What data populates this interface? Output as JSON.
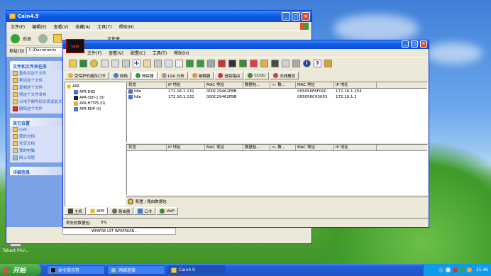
{
  "desktop": {
    "icons": [
      {
        "label": "Tekart Priv..."
      }
    ]
  },
  "explorer": {
    "title": "Cain4.9",
    "menu": [
      "文件(F)",
      "编辑(E)",
      "查看(V)",
      "收藏(A)",
      "工具(T)",
      "帮助(H)"
    ],
    "toolbar": {
      "back": "后退",
      "folders": "文件夹"
    },
    "address_label": "地址(D)",
    "address_value": "C:\\Documents",
    "tasks_panel": {
      "header": "文件和文件夹任务",
      "items": [
        "重命名这个文件",
        "移动这个文件",
        "复制这个文件",
        "将这个文件发布",
        "以电子邮件形式发送此文件",
        "删除这个文件"
      ]
    },
    "places_panel": {
      "header": "其它位置",
      "items": [
        "cain",
        "我的文档",
        "共享文档",
        "我的电脑",
        "网上邻居"
      ]
    },
    "details_panel": {
      "header": "详细信息"
    }
  },
  "cain": {
    "menu": [
      "文件(F)",
      "查看(V)",
      "配置(C)",
      "工具(T)",
      "帮助(H)"
    ],
    "tabs": [
      {
        "label": "受保护的缓存口令",
        "color": "#d8b23c"
      },
      {
        "label": "网络",
        "color": "#3c7fd8"
      },
      {
        "label": "嗅探器",
        "color": "#2d9a3a"
      },
      {
        "label": "LSA 分析",
        "color": "#9a9a9a"
      },
      {
        "label": "破解器",
        "color": "#c8a040"
      },
      {
        "label": "追踪路由",
        "color": "#cc3333"
      },
      {
        "label": "CCDU",
        "color": "#3a8a3a"
      },
      {
        "label": "无线概览",
        "color": "#cc4444"
      }
    ],
    "active_tab": "嗅探器",
    "tree": [
      {
        "label": "APR"
      },
      {
        "label": "APR-DNS"
      },
      {
        "label": "APR-SSH-1 (0)"
      },
      {
        "label": "APR-HTTPS (0)"
      },
      {
        "label": "APR-RDP (0)"
      }
    ],
    "grid_top": {
      "columns": [
        "状态",
        "IP 地址",
        "MAC 地址",
        "数据包...",
        "<- 数...",
        "MAC 地址",
        "IP 地址"
      ],
      "rows": [
        [
          "Idle",
          "172.16.1.131",
          "000C29462FBB",
          "",
          "",
          "005056F6F00C",
          "172.16.1.254"
        ],
        [
          "Idle",
          "172.16.1.131",
          "000C29462FBB",
          "",
          "",
          "005056C00003",
          "172.16.1.1"
        ]
      ]
    },
    "grid_bottom": {
      "columns": [
        "状态",
        "IP 地址",
        "MAC 地址",
        "数据包...",
        "<- 数...",
        "MAC 地址",
        "IP 地址"
      ]
    },
    "bottom_label": "配置 / 路由数据包",
    "bottom_tabs": [
      "主机",
      "APR",
      "路由器",
      "口令",
      "VoIP"
    ],
    "status": {
      "lost_label": "丢失的数据包:",
      "lost_value": "0%"
    },
    "extra_status": "WPAPSK LST    WPAPSKAN..."
  },
  "taskbar": {
    "start_label": "开始",
    "items": [
      {
        "label": "命令提示符",
        "active": false
      },
      {
        "label": "网络连接",
        "active": false
      },
      {
        "label": "Cain4.9",
        "active": true
      }
    ],
    "clock": "15:46"
  }
}
